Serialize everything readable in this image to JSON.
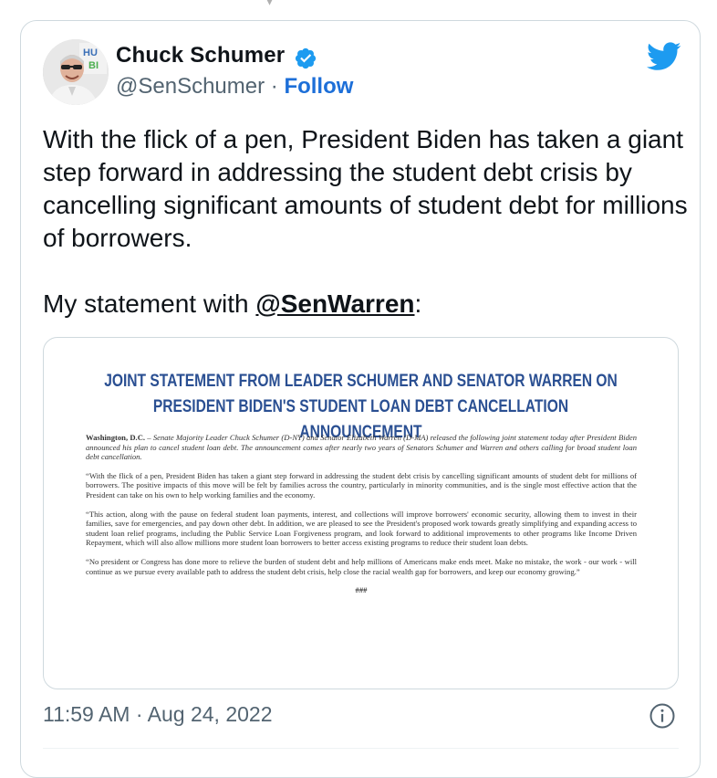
{
  "author": {
    "name": "Chuck Schumer",
    "handle": "@SenSchumer",
    "separator": " · ",
    "follow_label": "Follow",
    "verified_icon": "verified-badge-icon",
    "avatar_icon": "avatar-photo"
  },
  "brand": {
    "icon": "twitter-bird-icon",
    "color": "#1d9bf0"
  },
  "tweet": {
    "text_main": "With the flick of a pen, President Biden has taken a giant step forward in addressing the student debt crisis by cancelling significant amounts of student debt for millions of borrowers.",
    "text_prefix": "My statement with ",
    "mention": "@SenWarren",
    "text_suffix": ":"
  },
  "media": {
    "title_line1": "JOINT STATEMENT FROM LEADER SCHUMER AND SENATOR WARREN ON",
    "title_line2": "PRESIDENT BIDEN'S STUDENT LOAN DEBT CANCELLATION ANNOUNCEMENT",
    "dateline": "Washington, D.C.",
    "p1": " – Senate Majority Leader Chuck Schumer (D-NY) and Senator Elizabeth Warren (D-MA) released the following joint statement today after President Biden announced his plan to cancel student loan debt. The announcement comes after nearly two years of Senators Schumer and Warren and others calling for broad student loan debt cancellation.",
    "p2": "“With the flick of a pen, President Biden has taken a giant step forward in addressing the student debt crisis by cancelling significant amounts of student debt for millions of borrowers. The positive impacts of this move will be felt by families across the country, particularly in minority communities, and is the single most effective action that the President can take on his own to help working families and the economy.",
    "p3": "“This action, along with the pause on federal student loan payments, interest, and collections will improve borrowers' economic security, allowing them to invest in their families, save for emergencies, and pay down other debt. In addition, we are pleased to see the President's proposed work towards greatly simplifying and expanding access to student loan relief programs, including the Public Service Loan Forgiveness program, and look forward to additional improvements to other programs like Income Driven Repayment, which will also allow millions more student loan borrowers to better access existing programs to reduce their student loan debts.",
    "p4": "“No president or Congress has done more to relieve the burden of student debt and help millions of Americans make ends meet. Make no mistake, the work - our work - will continue as we pursue every available path to address the student debt crisis, help close the racial wealth gap for borrowers, and keep our economy growing.”",
    "end_mark": "###"
  },
  "footer": {
    "timestamp": "11:59 AM · Aug 24, 2022",
    "info_icon": "info-icon"
  }
}
